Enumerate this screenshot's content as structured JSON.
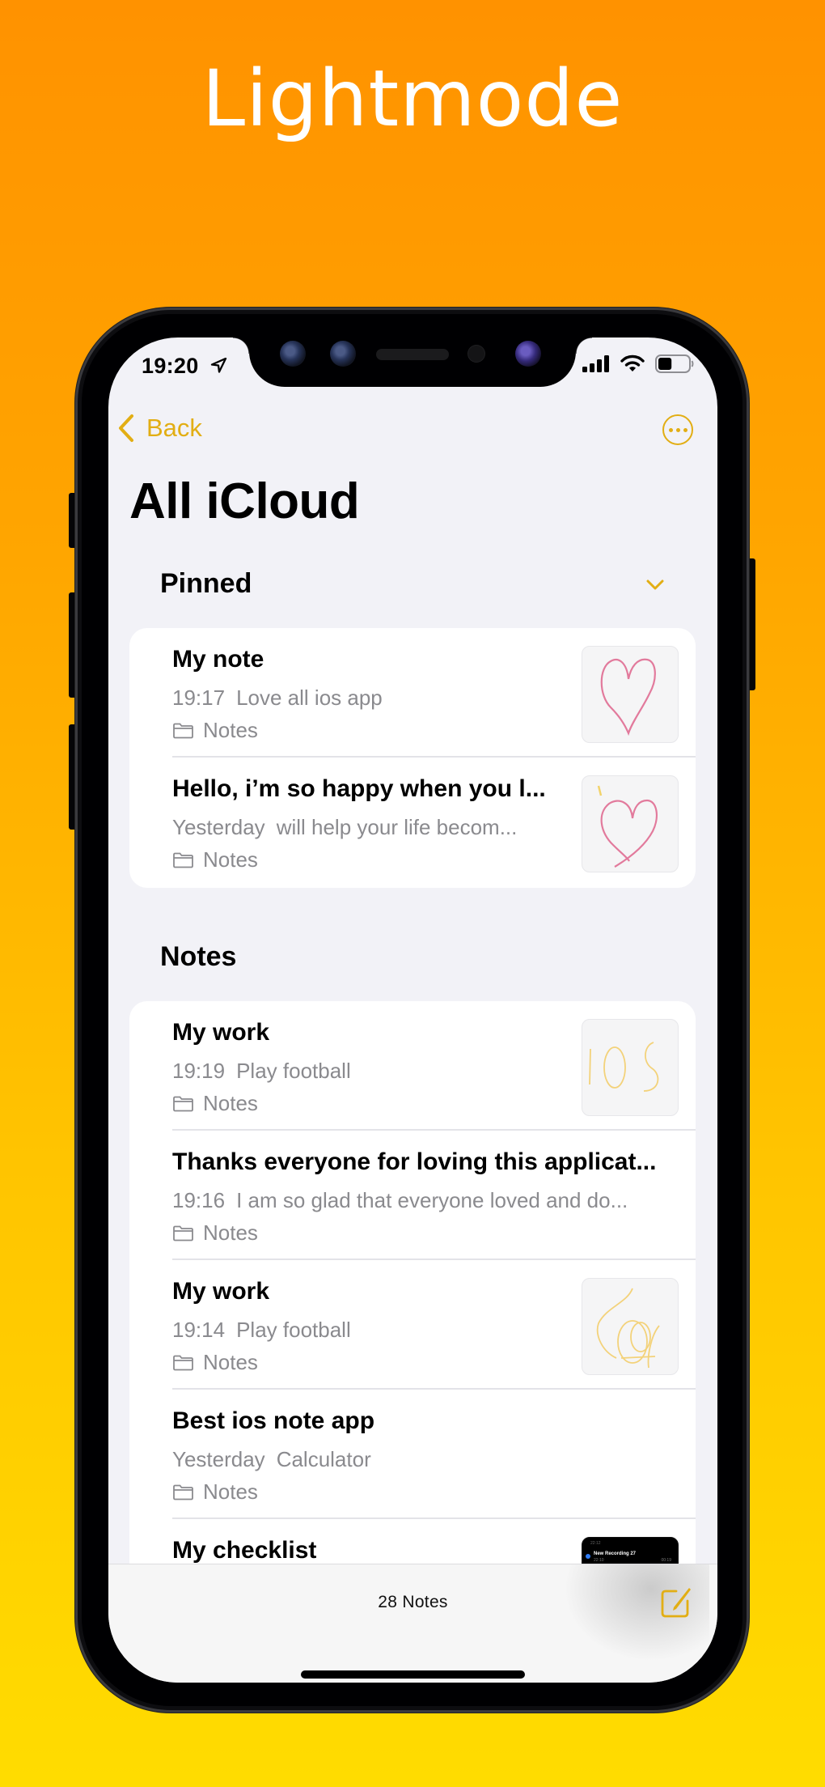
{
  "banner": {
    "headline": "Lightmode"
  },
  "colors": {
    "accent": "#E2AE14",
    "background_top": "#FF9200",
    "background_bottom": "#FFDC00",
    "secondary_text": "#8A8A8E"
  },
  "status_bar": {
    "time": "19:20",
    "location_icon": "location-arrow-icon",
    "signal_icon": "cellular-signal-icon",
    "wifi_icon": "wifi-icon",
    "battery_icon": "battery-icon",
    "battery_level_percent": 45
  },
  "nav": {
    "back_label": "Back",
    "back_icon": "chevron-left-icon",
    "more_icon": "ellipsis-circle-icon"
  },
  "page": {
    "title": "All iCloud"
  },
  "sections": {
    "pinned": {
      "header": "Pinned",
      "collapse_icon": "chevron-down-icon",
      "notes": [
        {
          "title": "My note",
          "date": "19:17",
          "preview": "Love all ios app",
          "folder": "Notes",
          "thumbnail": "pink heart sketch"
        },
        {
          "title": "Hello, i’m so happy when you l...",
          "date": "Yesterday",
          "preview": "will help your life becom...",
          "folder": "Notes",
          "thumbnail": "pink heart sketch"
        }
      ]
    },
    "notes": {
      "header": "Notes",
      "items": [
        {
          "title": "My work",
          "date": "19:19",
          "preview": "Play football",
          "folder": "Notes",
          "thumbnail": "IOS handwriting sketch"
        },
        {
          "title": "Thanks everyone for loving this applicat...",
          "date": "19:16",
          "preview": "I am so glad that everyone loved and do...",
          "folder": "Notes",
          "thumbnail": null
        },
        {
          "title": "My work",
          "date": "19:14",
          "preview": "Play football",
          "folder": "Notes",
          "thumbnail": "yellow scribble sketch"
        },
        {
          "title": "Best ios note app",
          "date": "Yesterday",
          "preview": "Calculator",
          "folder": "Notes",
          "thumbnail": null
        },
        {
          "title": "My checklist",
          "date": "",
          "preview": "",
          "folder": "",
          "thumbnail": "voice memo screenshot",
          "thumbnail_text": {
            "top_time": "22:12",
            "recording_name": "New Recording 27",
            "recording_time": "22:10",
            "duration": "00:19"
          }
        }
      ]
    }
  },
  "toolbar": {
    "note_count": "28 Notes",
    "compose_icon": "compose-icon"
  }
}
